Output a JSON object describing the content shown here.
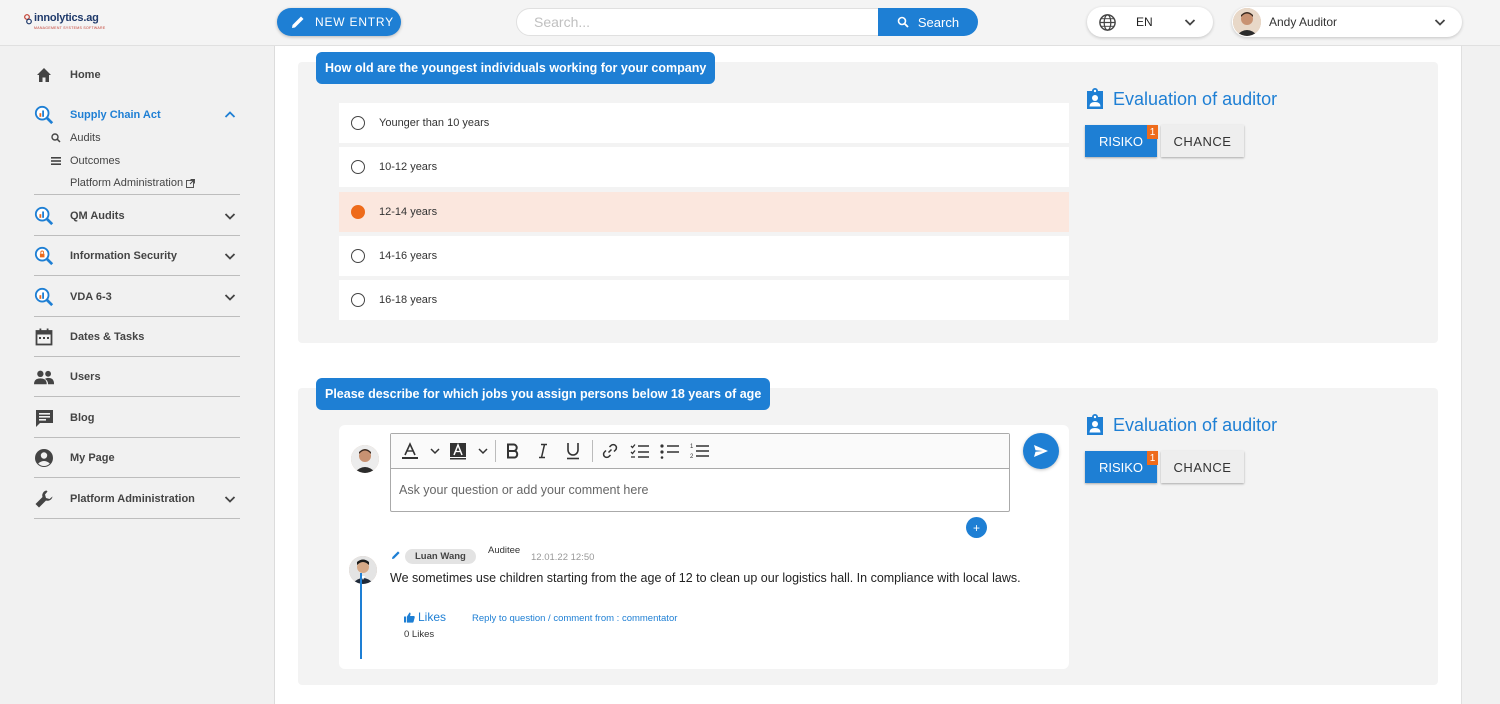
{
  "app": {
    "logo_text": "innolytics.ag",
    "logo_subtext": "MANAGEMENT SYSTEMS SOFTWARE"
  },
  "header": {
    "new_entry_label": "NEW ENTRY",
    "search_placeholder": "Search...",
    "search_button_label": "Search",
    "language": "EN",
    "user_name": "Andy Auditor"
  },
  "sidebar": {
    "items": [
      {
        "label": "Home",
        "icon": "home-icon"
      },
      {
        "label": "Supply Chain Act",
        "icon": "magnifier-chart-icon",
        "expanded": true
      },
      {
        "label": "QM Audits",
        "icon": "magnifier-chart-icon"
      },
      {
        "label": "Information Security",
        "icon": "magnifier-lock-icon"
      },
      {
        "label": "VDA 6-3",
        "icon": "magnifier-chart-icon"
      },
      {
        "label": "Dates & Tasks",
        "icon": "calendar-icon"
      },
      {
        "label": "Users",
        "icon": "users-icon"
      },
      {
        "label": "Blog",
        "icon": "chat-icon"
      },
      {
        "label": "My Page",
        "icon": "account-icon"
      },
      {
        "label": "Platform Administration",
        "icon": "wrench-icon"
      }
    ],
    "sub_items": [
      {
        "label": "Audits",
        "icon": "search-icon"
      },
      {
        "label": "Outcomes",
        "icon": "list-icon"
      },
      {
        "label": "Platform Administration",
        "icon": "external-link-icon"
      }
    ]
  },
  "question1": {
    "label": "How old are the youngest individuals working for your company",
    "options": [
      "Younger than 10 years",
      "10-12 years",
      "12-14 years",
      "14-16 years",
      "16-18 years"
    ],
    "selected_index": 2,
    "evaluation_title": "Evaluation of auditor",
    "risiko_label": "RISIKO",
    "risiko_badge": "1",
    "chance_label": "CHANCE"
  },
  "question2": {
    "label": "Please describe for which jobs you assign persons below 18 years of age",
    "editor_placeholder": "Ask your question or add your comment here",
    "evaluation_title": "Evaluation of auditor",
    "risiko_label": "RISIKO",
    "risiko_badge": "1",
    "chance_label": "CHANCE",
    "plus_label": "+",
    "comment": {
      "author": "Luan Wang",
      "role": "Auditee",
      "timestamp": "12.01.22 12:50",
      "text": "We sometimes use children starting from the age of 12 to clean up our logistics hall. In compliance with local laws.",
      "likes_label": "Likes",
      "reply_label": "Reply to question / comment from : commentator",
      "likes_count": "0 Likes"
    }
  },
  "colors": {
    "accent": "#1e7fd4",
    "selected_bg": "#fbe7de",
    "radio_selected": "#ee6b1b",
    "badge": "#ee6b1b"
  }
}
